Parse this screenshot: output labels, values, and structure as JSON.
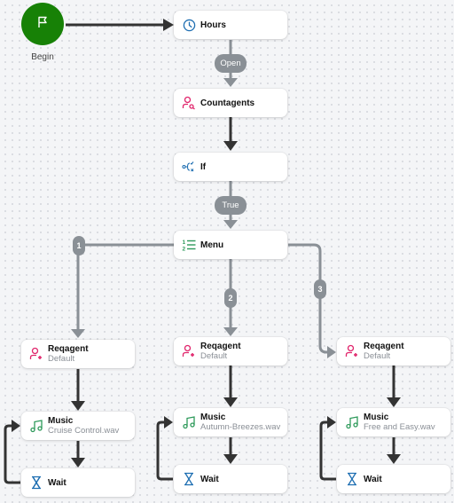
{
  "begin": {
    "label": "Begin",
    "icon": "flag-icon",
    "color": "#178106"
  },
  "nodes": {
    "hours": {
      "title": "Hours",
      "icon": "clock-icon"
    },
    "countagents": {
      "title": "Countagents",
      "icon": "user-search-icon"
    },
    "if": {
      "title": "If",
      "icon": "branch-icon"
    },
    "menu": {
      "title": "Menu",
      "icon": "numbered-list-icon"
    },
    "branch1": {
      "reqagent": {
        "title": "Reqagent",
        "subtitle": "Default",
        "icon": "user-add-icon"
      },
      "music": {
        "title": "Music",
        "subtitle": "Cruise Control.wav",
        "icon": "music-note-icon"
      },
      "wait": {
        "title": "Wait",
        "icon": "hourglass-icon"
      }
    },
    "branch2": {
      "reqagent": {
        "title": "Reqagent",
        "subtitle": "Default",
        "icon": "user-add-icon"
      },
      "music": {
        "title": "Music",
        "subtitle": "Autumn-Breezes.wav",
        "icon": "music-note-icon"
      },
      "wait": {
        "title": "Wait",
        "icon": "hourglass-icon"
      }
    },
    "branch3": {
      "reqagent": {
        "title": "Reqagent",
        "subtitle": "Default",
        "icon": "user-add-icon"
      },
      "music": {
        "title": "Music",
        "subtitle": "Free and Easy.wav",
        "icon": "music-note-icon"
      },
      "wait": {
        "title": "Wait",
        "icon": "hourglass-icon"
      }
    }
  },
  "edge_labels": {
    "hours_to_countagents": "Open",
    "if_to_menu": "True",
    "menu_option_1": "1",
    "menu_option_2": "2",
    "menu_option_3": "3"
  },
  "colors": {
    "edge_dark": "#333333",
    "edge_conditional": "#8a9096",
    "icon_blue": "#1f6fb2",
    "icon_pink": "#e0246b",
    "icon_green": "#2e9a5b"
  }
}
